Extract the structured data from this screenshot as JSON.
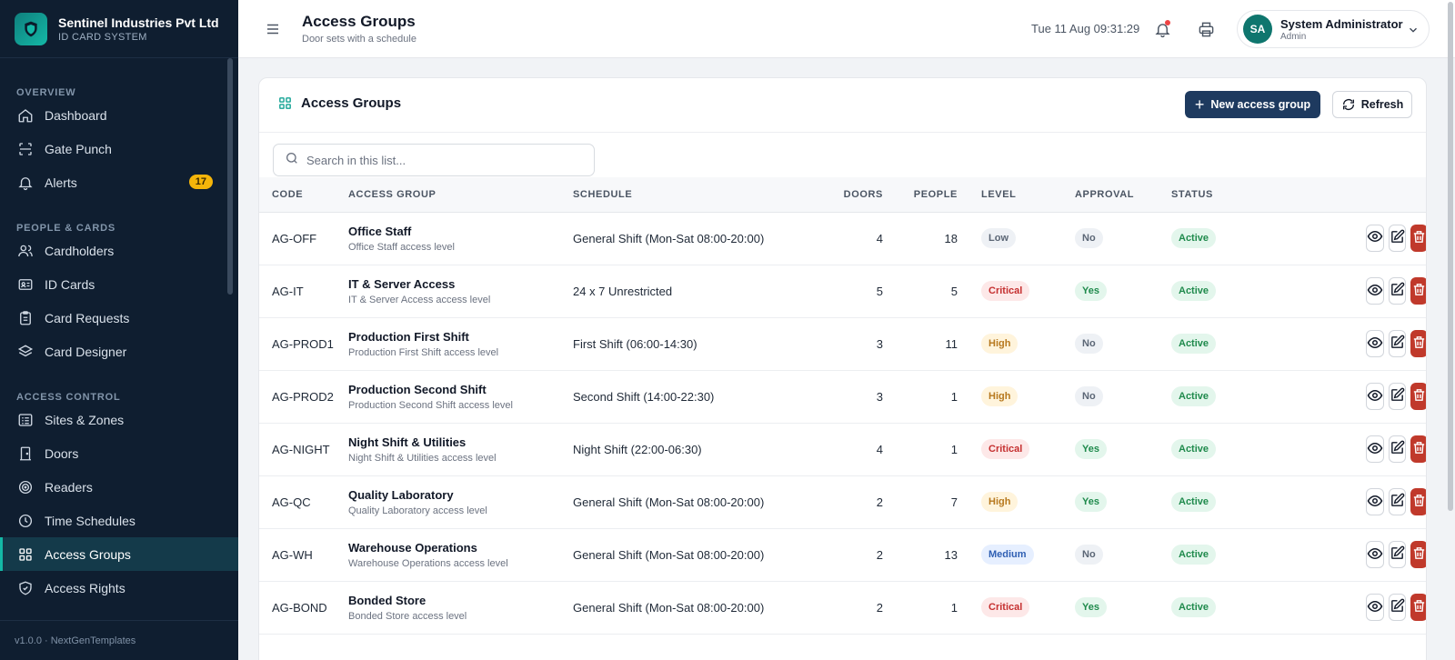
{
  "brand": {
    "name": "Sentinel Industries Pvt Ltd",
    "subtitle": "ID CARD SYSTEM"
  },
  "sidebar": {
    "sections": [
      {
        "title": "OVERVIEW",
        "items": [
          {
            "label": "Dashboard",
            "icon": "home-icon"
          },
          {
            "label": "Gate Punch",
            "icon": "scan-icon"
          },
          {
            "label": "Alerts",
            "icon": "bell-icon",
            "badge": "17"
          }
        ]
      },
      {
        "title": "PEOPLE & CARDS",
        "items": [
          {
            "label": "Cardholders",
            "icon": "users-icon"
          },
          {
            "label": "ID Cards",
            "icon": "id-card-icon"
          },
          {
            "label": "Card Requests",
            "icon": "clipboard-icon"
          },
          {
            "label": "Card Designer",
            "icon": "layers-icon"
          }
        ]
      },
      {
        "title": "ACCESS CONTROL",
        "items": [
          {
            "label": "Sites & Zones",
            "icon": "list-icon"
          },
          {
            "label": "Doors",
            "icon": "door-icon"
          },
          {
            "label": "Readers",
            "icon": "target-icon"
          },
          {
            "label": "Time Schedules",
            "icon": "clock-icon"
          },
          {
            "label": "Access Groups",
            "icon": "grid-icon",
            "active": true
          },
          {
            "label": "Access Rights",
            "icon": "shield-icon"
          }
        ]
      }
    ],
    "footer": "v1.0.0 · NextGenTemplates"
  },
  "header": {
    "title": "Access Groups",
    "subtitle": "Door sets with a schedule",
    "datetime": "Tue 11 Aug 09:31:29",
    "user": {
      "initials": "SA",
      "name": "System Administrator",
      "role": "Admin"
    }
  },
  "card": {
    "title": "Access Groups",
    "new_button": "New access group",
    "refresh_button": "Refresh",
    "search_placeholder": "Search in this list..."
  },
  "table": {
    "columns": [
      "CODE",
      "ACCESS GROUP",
      "SCHEDULE",
      "DOORS",
      "PEOPLE",
      "LEVEL",
      "APPROVAL",
      "STATUS"
    ],
    "rows": [
      {
        "code": "AG-OFF",
        "name": "Office Staff",
        "desc": "Office Staff access level",
        "schedule": "General Shift (Mon-Sat 08:00-20:00)",
        "doors": "4",
        "people": "18",
        "level": "Low",
        "approval": "No",
        "status": "Active"
      },
      {
        "code": "AG-IT",
        "name": "IT & Server Access",
        "desc": "IT & Server Access access level",
        "schedule": "24 x 7 Unrestricted",
        "doors": "5",
        "people": "5",
        "level": "Critical",
        "approval": "Yes",
        "status": "Active"
      },
      {
        "code": "AG-PROD1",
        "name": "Production First Shift",
        "desc": "Production First Shift access level",
        "schedule": "First Shift (06:00-14:30)",
        "doors": "3",
        "people": "11",
        "level": "High",
        "approval": "No",
        "status": "Active"
      },
      {
        "code": "AG-PROD2",
        "name": "Production Second Shift",
        "desc": "Production Second Shift access level",
        "schedule": "Second Shift (14:00-22:30)",
        "doors": "3",
        "people": "1",
        "level": "High",
        "approval": "No",
        "status": "Active"
      },
      {
        "code": "AG-NIGHT",
        "name": "Night Shift & Utilities",
        "desc": "Night Shift & Utilities access level",
        "schedule": "Night Shift (22:00-06:30)",
        "doors": "4",
        "people": "1",
        "level": "Critical",
        "approval": "Yes",
        "status": "Active"
      },
      {
        "code": "AG-QC",
        "name": "Quality Laboratory",
        "desc": "Quality Laboratory access level",
        "schedule": "General Shift (Mon-Sat 08:00-20:00)",
        "doors": "2",
        "people": "7",
        "level": "High",
        "approval": "Yes",
        "status": "Active"
      },
      {
        "code": "AG-WH",
        "name": "Warehouse Operations",
        "desc": "Warehouse Operations access level",
        "schedule": "General Shift (Mon-Sat 08:00-20:00)",
        "doors": "2",
        "people": "13",
        "level": "Medium",
        "approval": "No",
        "status": "Active"
      },
      {
        "code": "AG-BOND",
        "name": "Bonded Store",
        "desc": "Bonded Store access level",
        "schedule": "General Shift (Mon-Sat 08:00-20:00)",
        "doors": "2",
        "people": "1",
        "level": "Critical",
        "approval": "Yes",
        "status": "Active"
      }
    ]
  },
  "colors": {
    "sidebar_bg": "#0f1e30",
    "accent": "#14b8a6",
    "primary_button": "#1e3a5f",
    "danger": "#c0392b",
    "badge": "#f5b50a"
  }
}
